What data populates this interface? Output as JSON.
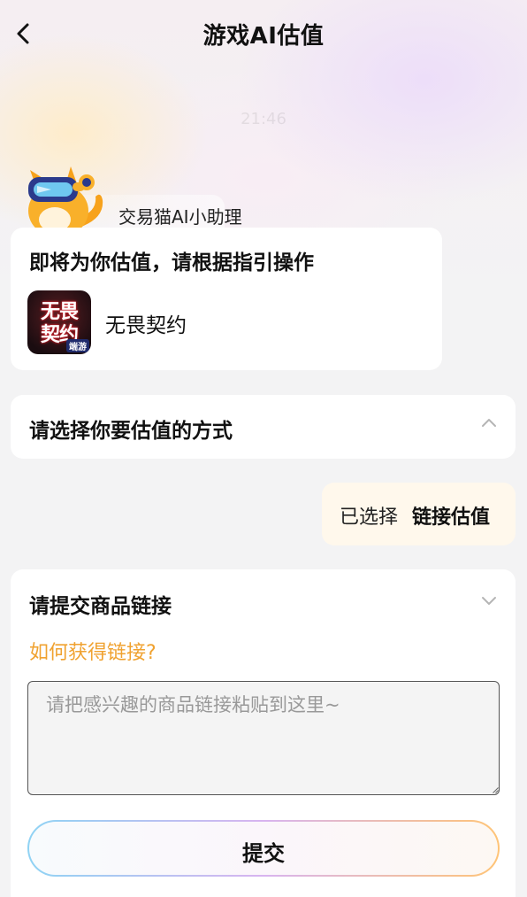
{
  "header": {
    "title": "游戏AI估值",
    "back_icon": "chevron-left-icon"
  },
  "background_time": "21:46",
  "assistant": {
    "name": "交易猫AI小助理",
    "avatar": "cat-mascot-vr-avatar"
  },
  "intro": {
    "heading": "即将为你估值，请根据指引操作",
    "game": {
      "name": "无畏契约",
      "icon_line1": "无畏",
      "icon_line2": "契约",
      "icon_tag": "端游"
    }
  },
  "method": {
    "title": "请选择你要估值的方式",
    "toggle_icon": "chevron-up-icon"
  },
  "selection": {
    "prefix": "已选择",
    "value": "链接估值"
  },
  "link_form": {
    "title": "请提交商品链接",
    "toggle_icon": "chevron-down-icon",
    "help_link": "如何获得链接?",
    "input": {
      "value": "",
      "placeholder": "请把感兴趣的商品链接粘贴到这里~"
    },
    "submit_label": "提交"
  },
  "colors": {
    "accent_orange": "#f0a230",
    "page_background": "#f3f3f4",
    "card_background": "#ffffff",
    "selected_bubble_background": "#fff8ec"
  }
}
